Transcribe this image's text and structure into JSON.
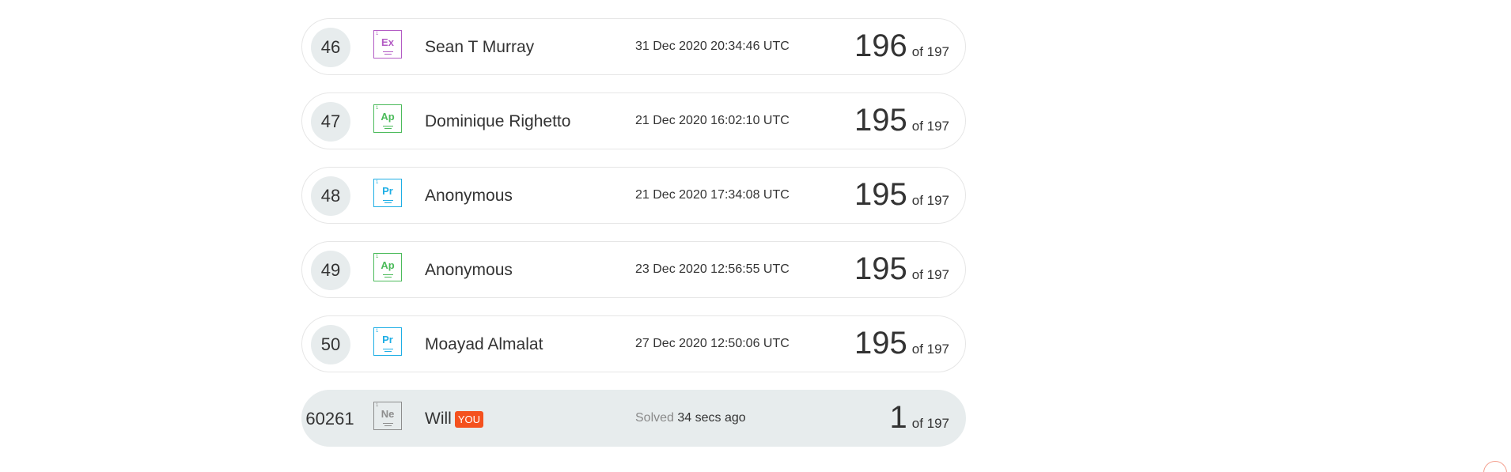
{
  "leaderboard": {
    "rows": [
      {
        "rank": "46",
        "element": {
          "number": "1",
          "symbol": "Ex",
          "color": "#b35bc4"
        },
        "name": "Sean T Murray",
        "date": "31 Dec 2020 20:34:46 UTC",
        "score": "196",
        "of_total": "of 197"
      },
      {
        "rank": "47",
        "element": {
          "number": "1",
          "symbol": "Ap",
          "color": "#4cbb5b"
        },
        "name": "Dominique Righetto",
        "date": "21 Dec 2020 16:02:10 UTC",
        "score": "195",
        "of_total": "of 197"
      },
      {
        "rank": "48",
        "element": {
          "number": "1",
          "symbol": "Pr",
          "color": "#1eaee5"
        },
        "name": "Anonymous",
        "date": "21 Dec 2020 17:34:08 UTC",
        "score": "195",
        "of_total": "of 197"
      },
      {
        "rank": "49",
        "element": {
          "number": "1",
          "symbol": "Ap",
          "color": "#4cbb5b"
        },
        "name": "Anonymous",
        "date": "23 Dec 2020 12:56:55 UTC",
        "score": "195",
        "of_total": "of 197"
      },
      {
        "rank": "50",
        "element": {
          "number": "1",
          "symbol": "Pr",
          "color": "#1eaee5"
        },
        "name": "Moayad Almalat",
        "date": "27 Dec 2020 12:50:06 UTC",
        "score": "195",
        "of_total": "of 197"
      }
    ],
    "you_row": {
      "rank": "60261",
      "element": {
        "number": "1",
        "symbol": "Ne",
        "color": "#8d8d8d"
      },
      "name": "Will",
      "badge": "YOU",
      "solved_label": "Solved",
      "solved_time": "34 secs ago",
      "score": "1",
      "of_total": "of 197"
    }
  },
  "scroll_top": {
    "icon": "chevron-up-icon",
    "glyph": "︿"
  }
}
